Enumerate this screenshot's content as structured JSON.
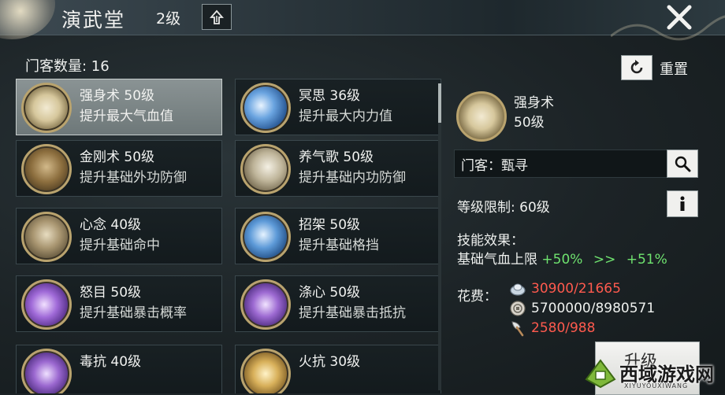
{
  "header": {
    "title": "演武堂",
    "level": "2级"
  },
  "disciple_count": "门客数量: 16",
  "reset_label": "重置",
  "skills": [
    {
      "name": "强身术 50级",
      "desc": "提升最大气血值",
      "selected": true
    },
    {
      "name": "冥思 36级",
      "desc": "提升最大内力值"
    },
    {
      "name": "金刚术 50级",
      "desc": "提升基础外功防御"
    },
    {
      "name": "养气歌 50级",
      "desc": "提升基础内功防御"
    },
    {
      "name": "心念 40级",
      "desc": "提升基础命中"
    },
    {
      "name": "招架 50级",
      "desc": "提升基础格挡"
    },
    {
      "name": "怒目 50级",
      "desc": "提升基础暴击概率"
    },
    {
      "name": "涤心 50级",
      "desc": "提升基础暴击抵抗"
    },
    {
      "name": "毒抗 40级",
      "desc": ""
    },
    {
      "name": "火抗 30级",
      "desc": ""
    }
  ],
  "detail": {
    "name": "强身术",
    "level": "50级",
    "disciple": "门客：甄寻",
    "level_limit": "等级限制: 60级",
    "effect_label": "技能效果：",
    "effect_prefix": "基础气血上限",
    "effect_from": "+50%",
    "effect_arrow": ">>",
    "effect_to": "+51%",
    "cost_label": "花费：",
    "costs": [
      {
        "value": "30900/21665",
        "color": "#ff5a4e",
        "icon": "silver-ingot-icon"
      },
      {
        "value": "5700000/8980571",
        "color": "#eef0ee",
        "icon": "coin-icon"
      },
      {
        "value": "2580/988",
        "color": "#ff5a4e",
        "icon": "axe-icon"
      }
    ],
    "upgrade_label": "升级"
  },
  "watermark": {
    "text": "西域游戏网",
    "sub": "XIYUYOUXIWANG"
  }
}
